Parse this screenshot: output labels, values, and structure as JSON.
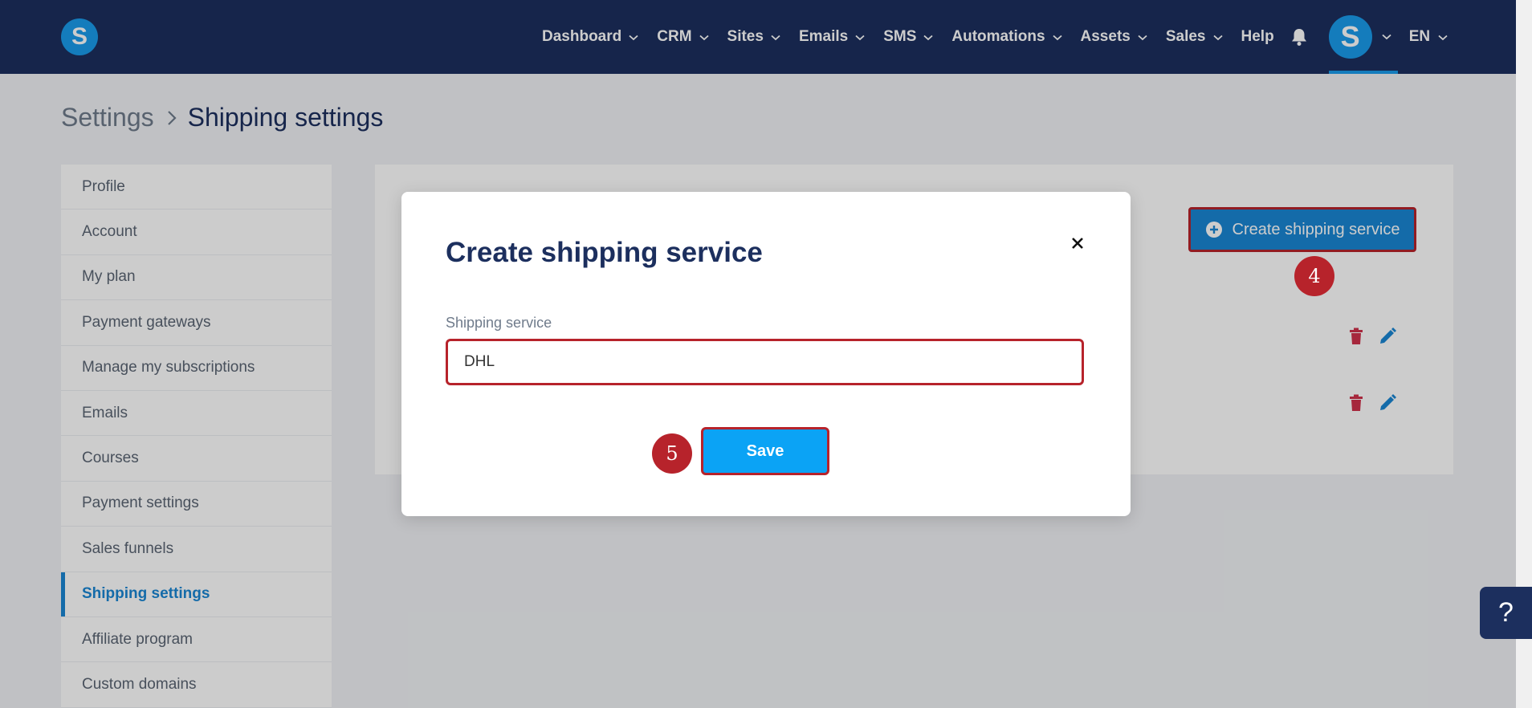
{
  "header": {
    "logo_letter": "S",
    "nav": [
      {
        "label": "Dashboard"
      },
      {
        "label": "CRM"
      },
      {
        "label": "Sites"
      },
      {
        "label": "Emails"
      },
      {
        "label": "SMS"
      },
      {
        "label": "Automations"
      },
      {
        "label": "Assets"
      },
      {
        "label": "Sales"
      }
    ],
    "help_label": "Help",
    "avatar_letter": "S",
    "language": "EN"
  },
  "breadcrumb": {
    "parent": "Settings",
    "current": "Shipping settings"
  },
  "sidebar": {
    "items": [
      {
        "label": "Profile"
      },
      {
        "label": "Account"
      },
      {
        "label": "My plan"
      },
      {
        "label": "Payment gateways"
      },
      {
        "label": "Manage my subscriptions"
      },
      {
        "label": "Emails"
      },
      {
        "label": "Courses"
      },
      {
        "label": "Payment settings"
      },
      {
        "label": "Sales funnels"
      },
      {
        "label": "Shipping settings",
        "active": true
      },
      {
        "label": "Affiliate program"
      },
      {
        "label": "Custom domains"
      }
    ]
  },
  "content": {
    "create_button_label": "Create shipping service"
  },
  "modal": {
    "title": "Create shipping service",
    "field_label": "Shipping service",
    "field_value": "DHL",
    "save_label": "Save"
  },
  "badges": {
    "step_create": "4",
    "step_save": "5"
  },
  "help_widget": {
    "label": "?"
  },
  "colors": {
    "nav_bg": "#1c2f5e",
    "brand_blue": "#1a9bec",
    "primary_button": "#1a86d4",
    "save_button": "#0ba3f5",
    "highlight_red": "#b7232b",
    "delete_icon": "#d0314b",
    "edit_icon": "#1a86d4"
  }
}
